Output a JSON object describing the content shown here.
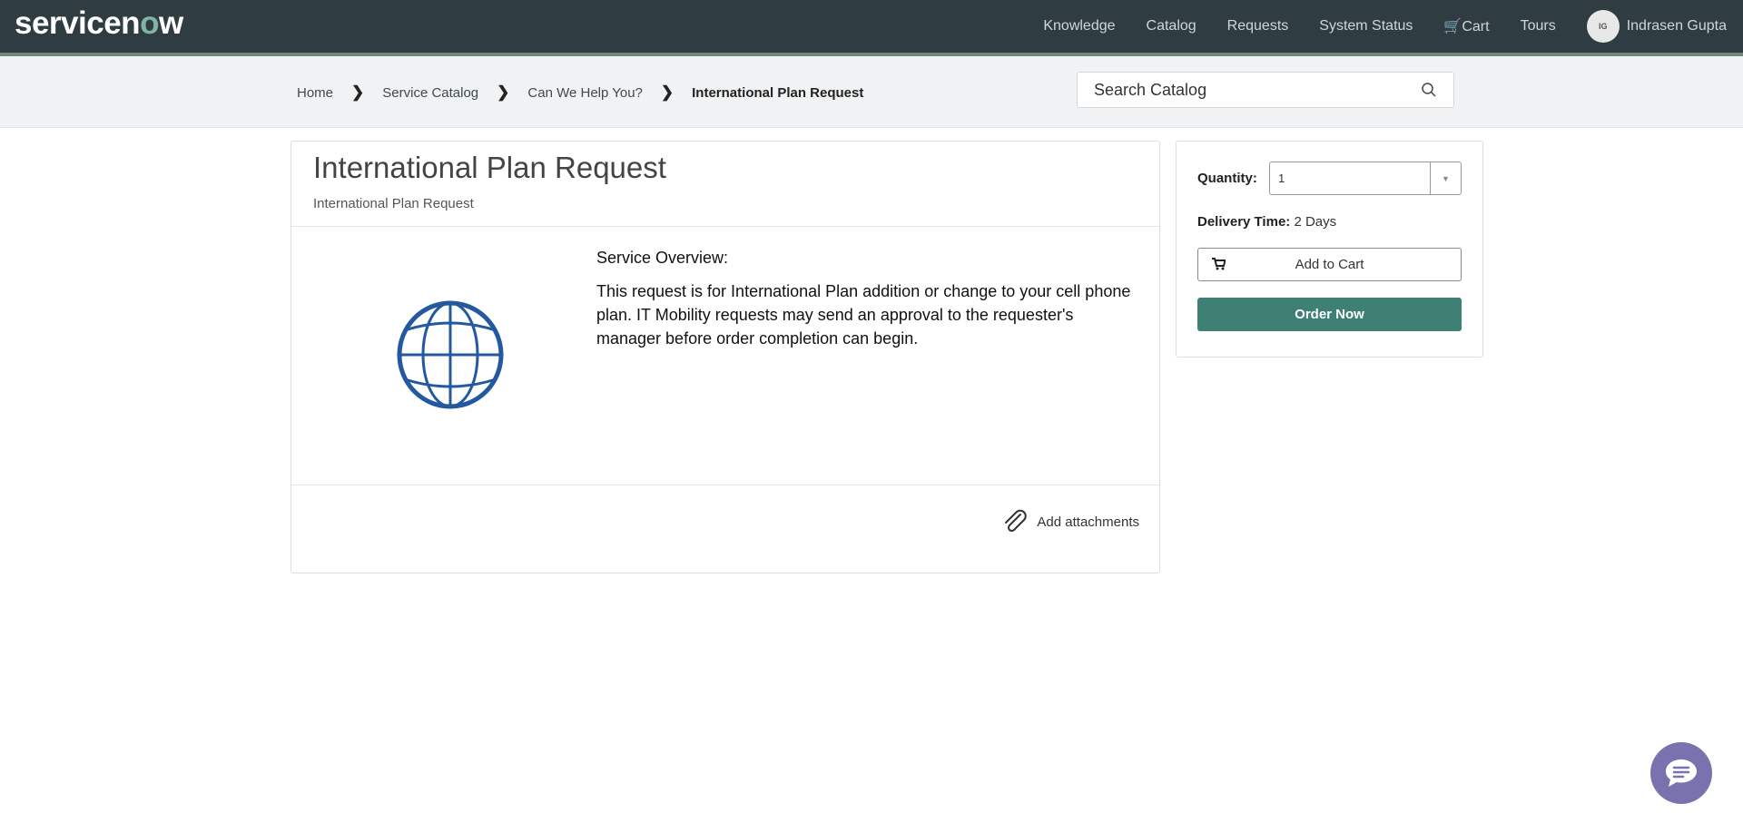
{
  "header": {
    "logo": "servicenow",
    "nav": [
      "Knowledge",
      "Catalog",
      "Requests",
      "System Status",
      "Cart",
      "Tours"
    ],
    "user_initials": "IG",
    "user_name": "Indrasen Gupta"
  },
  "breadcrumb": [
    "Home",
    "Service Catalog",
    "Can We Help You?",
    "International Plan Request"
  ],
  "search": {
    "placeholder": "Search Catalog"
  },
  "item": {
    "title": "International Plan Request",
    "subtitle": "International Plan Request",
    "overview_heading": "Service Overview:",
    "overview_text": "This request is for International Plan addition or change to your cell phone plan. IT Mobility requests may send an approval to the requester's manager before order completion can begin.",
    "attach_label": "Add attachments",
    "icon": "globe-icon"
  },
  "order": {
    "quantity_label": "Quantity:",
    "quantity_value": "1",
    "delivery_label": "Delivery Time:",
    "delivery_value": "2 Days",
    "add_to_cart": "Add to Cart",
    "order_now": "Order Now"
  },
  "colors": {
    "header": "#2f3d42",
    "accent": "#3f8074",
    "globe": "#2458a0",
    "chat": "#7872af"
  }
}
